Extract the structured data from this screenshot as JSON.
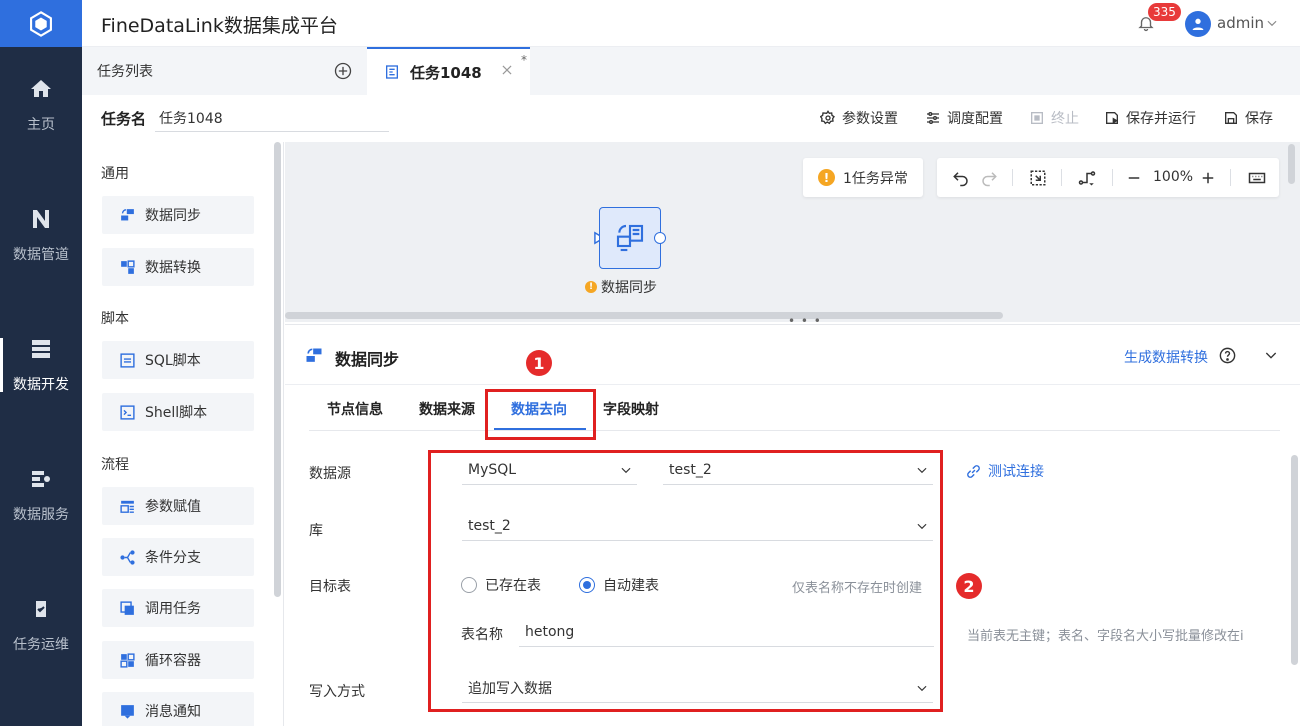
{
  "app": {
    "title": "FineDataLink数据集成平台"
  },
  "header": {
    "notification_count": "335",
    "user": "admin"
  },
  "nav": {
    "items": [
      {
        "label": "主页",
        "icon": "home-icon"
      },
      {
        "label": "数据管道",
        "icon": "pipeline-icon"
      },
      {
        "label": "数据开发",
        "icon": "data-dev-icon",
        "active": true
      },
      {
        "label": "数据服务",
        "icon": "data-service-icon"
      },
      {
        "label": "任务运维",
        "icon": "task-ops-icon"
      }
    ]
  },
  "tabs": {
    "list_label": "任务列表",
    "active_label": "任务1048",
    "active_modified": "*"
  },
  "task": {
    "name_label": "任务名",
    "name_value": "任务1048"
  },
  "toolbar": {
    "params": "参数设置",
    "schedule": "调度配置",
    "stop": "终止",
    "save_run": "保存并运行",
    "save": "保存"
  },
  "left_panel": {
    "categories": [
      "通用",
      "脚本",
      "流程"
    ],
    "general": [
      "数据同步",
      "数据转换"
    ],
    "script": [
      "SQL脚本",
      "Shell脚本"
    ],
    "flow": [
      "参数赋值",
      "条件分支",
      "调用任务",
      "循环容器",
      "消息通知"
    ]
  },
  "canvas": {
    "warning": "1任务异常",
    "warning_mark": "!",
    "zoom": "100%",
    "node_label": "数据同步"
  },
  "panel": {
    "title": "数据同步",
    "generate": "生成数据转换",
    "tabs": [
      "节点信息",
      "数据来源",
      "数据去向",
      "字段映射"
    ],
    "active_tab": "数据去向"
  },
  "annotations": [
    "1",
    "2"
  ],
  "form": {
    "datasource_label": "数据源",
    "datasource_type": "MySQL",
    "datasource_conn": "test_2",
    "test_connection": "测试连接",
    "db_label": "库",
    "db_value": "test_2",
    "target_label": "目标表",
    "radio_existing": "已存在表",
    "radio_auto": "自动建表",
    "auto_hint": "仅表名称不存在时创建",
    "table_name_label": "表名称",
    "table_name_value": "hetong",
    "table_hint": "当前表无主键；表名、字段名大小写批量修改在i",
    "write_label": "写入方式",
    "write_value": "追加写入数据"
  },
  "colors": {
    "accent": "#2f6fde",
    "nav_bg": "#1f2d45",
    "highlight": "#e02020",
    "warning": "#f5a623"
  }
}
